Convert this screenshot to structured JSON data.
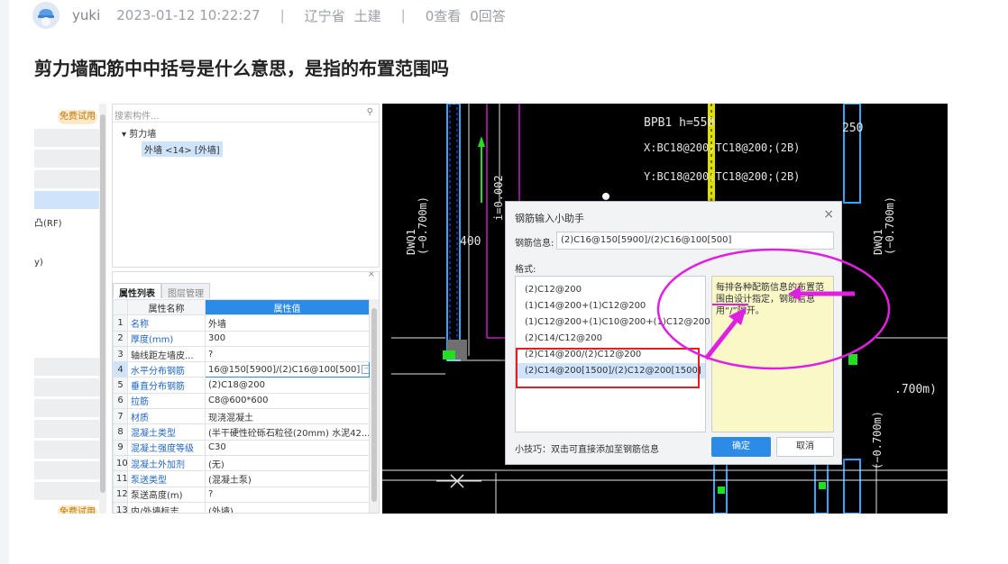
{
  "post": {
    "author": "yuki",
    "datetime": "2023-01-12 10:22:27",
    "separator": "|",
    "location": "辽宁省",
    "category": "土建",
    "views": "0查看",
    "answers": "0回答",
    "title": "剪力墙配筋中中括号是什么意思，是指的布置范围吗"
  },
  "app": {
    "badge": "免费试用",
    "left_text_1": "凸(RF)",
    "left_text_2": "y)",
    "search_placeholder": "搜索构件...",
    "search_icon": "magnifier-icon",
    "tree_root": "▾ 剪力墙",
    "tree_child": "外墙 <14> [外墙]",
    "tabs": [
      "属性列表",
      "图层管理"
    ],
    "table_headers": [
      "属性名称",
      "属性值"
    ],
    "rows": [
      {
        "num": "1",
        "name": "名称",
        "value": "外墙",
        "blue": true
      },
      {
        "num": "2",
        "name": "厚度(mm)",
        "value": "300",
        "blue": true
      },
      {
        "num": "3",
        "name": "轴线距左墙皮...",
        "value": "?",
        "blue": false
      },
      {
        "num": "4",
        "name": "水平分布钢筋",
        "value": "16@150[5900]/(2)C16@100[500]",
        "blue": true
      },
      {
        "num": "5",
        "name": "垂直分布钢筋",
        "value": "(2)C18@200",
        "blue": true
      },
      {
        "num": "6",
        "name": "拉筋",
        "value": "C8@600*600",
        "blue": true
      },
      {
        "num": "7",
        "name": "材质",
        "value": "现浇混凝土",
        "blue": true
      },
      {
        "num": "8",
        "name": "混凝土类型",
        "value": "(半干硬性砼砾石粒径(20mm) 水泥42...",
        "blue": true
      },
      {
        "num": "9",
        "name": "混凝土强度等级",
        "value": "C30",
        "blue": true
      },
      {
        "num": "10",
        "name": "混凝土外加剂",
        "value": "(无)",
        "blue": true
      },
      {
        "num": "11",
        "name": "泵送类型",
        "value": "(混凝土泵)",
        "blue": true
      },
      {
        "num": "12",
        "name": "泵送高度(m)",
        "value": "?",
        "blue": false
      },
      {
        "num": "13",
        "name": "内/外墙标志",
        "value": "(外墙)",
        "blue": false
      }
    ]
  },
  "cad": {
    "label_bpb1": "BPB1  h=550",
    "label_x": "X:BC18@200;TC18@200;(2B)",
    "label_y": "Y:BC18@200;TC18@200;(2B)",
    "label_250": "250",
    "label_i": "i=0.002",
    "label_dwq1_left": "DWQ1\n(−0.700m)",
    "label_dwq1_right": "DWQ1\n(−0.700m)",
    "label_400": "400",
    "label_700m": ".700m)",
    "label_bottom": "(−0.700m)"
  },
  "dialog": {
    "title": "钢筋输入小助手",
    "close": "×",
    "field_label": "钢筋信息:",
    "field_value": "(2)C16@150[5900]/(2)C16@100[500]",
    "format_label": "格式:",
    "formats": [
      "(2)C12@200",
      "(1)C14@200+(1)C12@200",
      "(1)C12@200+(1)C10@200+(1)C12@200",
      "(2)C14/C12@200",
      "(2)C14@200/(2)C12@200",
      "(2)C14@200[1500]/(2)C12@200[1500]"
    ],
    "selected_index": 5,
    "hint": "每排各种配筋信息的布置范围由设计指定，钢筋信息用“/”隔开。",
    "tip": "小技巧：双击可直接添加至钢筋信息",
    "ok": "确定",
    "cancel": "取消"
  },
  "colors": {
    "accent": "#2b8be6",
    "annotation_magenta": "#e020e0",
    "annotation_red": "#e02020",
    "cad_background": "#000000",
    "cad_cyan": "#30a8ff",
    "cad_yellow": "#ffff00",
    "cad_green": "#20e020"
  }
}
